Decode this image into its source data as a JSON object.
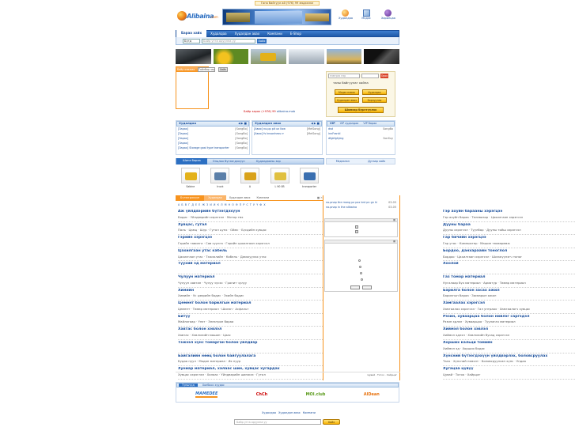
{
  "top_notice": "Гана байгуул ай (976) 99 мэдээлэл",
  "logo": {
    "mark": "Alibaina",
    "suffix": ".com"
  },
  "header_icons": [
    {
      "label": "Худалдаа"
    },
    {
      "label": "Мэдээ"
    },
    {
      "label": "Харилцаа"
    }
  ],
  "nav_tabs": [
    "Бараа хайх",
    "Худалдаа",
    "Худалдан авах",
    "Компани",
    "E-Shop"
  ],
  "search": {
    "select": "Бүгд",
    "placeholder": "Байр утга оруулна уу",
    "button": "Хайх"
  },
  "ad_line": {
    "prefix": "Байр зарах",
    "phone": "(+976) 99",
    "site": "alibaina.mob"
  },
  "login": {
    "username_placeholder": "нэвтрэх нэр",
    "go": "Орох",
    "welcome": "таны байгуулаг хайна",
    "buttons": [
      "Мэдээ нэмэх",
      "Худалдах",
      "Худалдан авах",
      "Борлуулах"
    ],
    "register": "Шинээр бүртгүүлэх"
  },
  "sell_box": {
    "title": "Худалдаа",
    "rows": [
      {
        "t": "[Зарах]",
        "d": "[SongBo]"
      },
      {
        "t": "[Зарах]",
        "d": "[SongBo]"
      },
      {
        "t": "[Зарах]",
        "d": "[SongBo]"
      },
      {
        "t": "[Зарах]",
        "d": "[SongBo]"
      },
      {
        "t": "[Зарах] Storage goal type transporter",
        "d": "[SongBo]"
      }
    ]
  },
  "buy_box": {
    "title": "Худалдан авах",
    "rows": [
      {
        "t": "[Авах] no.pp pit oz llow",
        "d": "[MelSong]"
      },
      {
        "t": "[Авах] fs knsonhess rr",
        "d": "[MelSong]"
      }
    ]
  },
  "vip_box": {
    "tabs": [
      "VIP",
      "VIP худалдаа",
      "VIP бараа"
    ],
    "rows": [
      {
        "t": "dsd",
        "d": "SongBo"
      },
      {
        "t": "innFrankl",
        "d": ""
      },
      {
        "t": "dfgkfghjmg",
        "d": "SonSuy"
      }
    ]
  },
  "product_tabs": [
    "Шинэ бараа",
    "Онцлох бүтээгдэхүүн",
    "Худалдааны зар"
  ],
  "products": [
    {
      "label": "Sabine"
    },
    {
      "label": "truck"
    },
    {
      "label": "A"
    },
    {
      "label": "L 90 0B"
    },
    {
      "label": "transporter"
    }
  ],
  "side_tabs": [
    "Мэдээлэл",
    "Дугаар хайх"
  ],
  "cat_tabs": [
    "Бүтээгдэхүүн",
    "Худалдаа",
    "Худалдан авах",
    "Компани"
  ],
  "alpha": "А Б В Г Д Е Ё Ж З И Й К Л М Н О Ө П Р С Т У Ү Ф Х",
  "center_news": [
    {
      "t": "no.pnap the mang pz pxx bnt pn gn hi",
      "d": "03-05"
    },
    {
      "t": "no.pnap in the alibaina",
      "d": "03-05"
    }
  ],
  "categories_left": [
    {
      "title": "Аж үйлдвэрийн бүтээгдэхүүн",
      "sub": "Бодис · Үйлдвэрийн хэрэгсэл · Мотор төх"
    },
    {
      "title": "Хувцас, гутал",
      "sub": "Паль · Цамц · Шүр · Гутал цүнх · Оймс · Бүсдийн хувцас"
    },
    {
      "title": "Гэрийн хэрэгцээ",
      "sub": "Гэрийн тавилга · Сав суулга · Гэрийн цахилгаан хэрэгсэл"
    },
    {
      "title": "Цахилгаан утас кабель",
      "sub": "Цахилгаан утас · Тэжээлийн · Кабель · Дамжуулах утас"
    },
    {
      "title": "Түухий эд материал",
      "sub": ""
    },
    {
      "title": "Чулуун материал",
      "sub": "Чулуун хавтан · Чулуу зүсэх · Гранит чулуу"
    },
    {
      "title": "Химийн",
      "sub": "Химийн · Ус цэврийн бодис · Эхийн бодис"
    },
    {
      "title": "Цемент болон барилгын материал",
      "sub": "Цемент · Төмөр материал · Шилэн · Асфальт"
    },
    {
      "title": "Битүү",
      "sub": "Майлагаар · Үнэт · Электрон бараа"
    },
    {
      "title": "Хавтас болон хэвлэл",
      "sub": "Хавтас · Хэвлэлийн машин · Цаас"
    },
    {
      "title": "Тэжээл хүнс томарган болон үйлдвэр",
      "sub": ""
    },
    {
      "title": "Байгалийн нөөц болон байгуулалага",
      "sub": "Будаа нуул · Модон материал · Их нуур"
    },
    {
      "title": "Хуниар материал, халаас шин, хувцас хугардах",
      "sub": "Хувцас хэрэглэл · Халаас · Үйлдвэрийн шинжээ · Гутал"
    }
  ],
  "categories_right": [
    {
      "title": "Гэр ахуйн барааны хэрэгцээ",
      "sub": "Гэр ахуйн бараа · Телевизор · Цахилгаан хэрэгсэл"
    },
    {
      "title": "Дууны бараа",
      "sub": "Дууны хэрэгсэл · Туулбар · Дууны тийш хэрэгсэл"
    },
    {
      "title": "Гар бичийн хэрэгцээ",
      "sub": "Гар утас · Компьютер · Машин төхөөрөмж"
    },
    {
      "title": "Бордоо, данхараайн тоноглол",
      "sub": "Бордоо · Цахилгаан хэрэгсэл · Шилжүүлэгч тоног"
    },
    {
      "title": "Хоолой",
      "sub": ""
    },
    {
      "title": "Газ томор материал",
      "sub": "Нугалаар бүх материал · Арматур · Төмөр материал"
    },
    {
      "title": "Барилга болон засах ажил",
      "sub": "Барилгын бараа · Засварын ажил"
    },
    {
      "title": "Хамгаалах хэрэгсэл",
      "sub": "Хамгаалах хэрэгсэл · Гал унтраах · Хамгаалагч хувцас"
    },
    {
      "title": "Рэзин, хуваарцаа болон нийлэг саргэдэл",
      "sub": "Рэзин эдлэл · Хуваарцаа · Туулагач материал"
    },
    {
      "title": "Хиймэл болон хэвлэл",
      "sub": "Хиймэл эдлэл · Хэвлэлийн бусад хэрэгсэл"
    },
    {
      "title": "Хорших кальци томийн",
      "sub": "Хиймэл эд · Хорших бодис"
    },
    {
      "title": "Хүнсний бүтээгдэхүүн үйлдвэрлэх, боловсруулах",
      "sub": "Талх · Хүнсний нэмэлт · Боловсруулсан хүнс · Ундаа"
    },
    {
      "title": "Хугацаа цүвүү",
      "sub": "Цувай · Тогоо · Хайрцаг"
    }
  ],
  "left_panel_tabs": [
    "Байр хэмжих",
    "Тайлбар зар"
  ],
  "partner_tabs": [
    "Түншүүд",
    "Холбоос хуудас"
  ],
  "partners": [
    "MAMEDEE",
    "ChCh",
    "MOI.club",
    "AlDean"
  ],
  "footer": {
    "links": [
      "Худалдаа",
      "Худалдан авах",
      "Компани"
    ],
    "placeholder": "Байр утга оруулна уу",
    "button": "Хайх"
  },
  "colors": {
    "brand": "#1a4f9c",
    "accent": "#f7931e",
    "tab_active": "#2c6fc2"
  }
}
